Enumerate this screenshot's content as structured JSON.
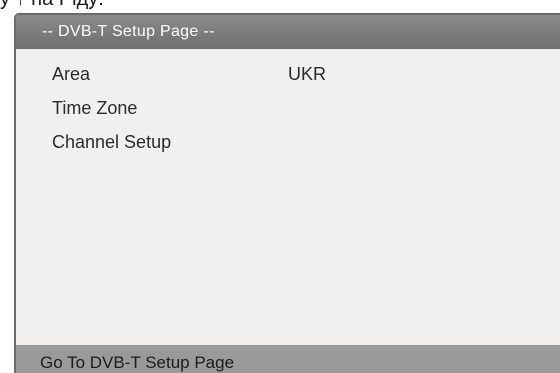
{
  "top_fragment": "у ↑ на Ріду:",
  "header": {
    "title": "-- DVB-T Setup Page --"
  },
  "menu": {
    "items": [
      {
        "label": "Area",
        "value": "UKR"
      },
      {
        "label": "Time Zone",
        "value": ""
      },
      {
        "label": "Channel Setup",
        "value": ""
      }
    ]
  },
  "footer": {
    "status": "Go To DVB-T Setup Page"
  },
  "colors": {
    "header_bar": "#7c7c7c",
    "screen_background": "#f1f0ee",
    "footer_bar": "#9a9a9a"
  }
}
